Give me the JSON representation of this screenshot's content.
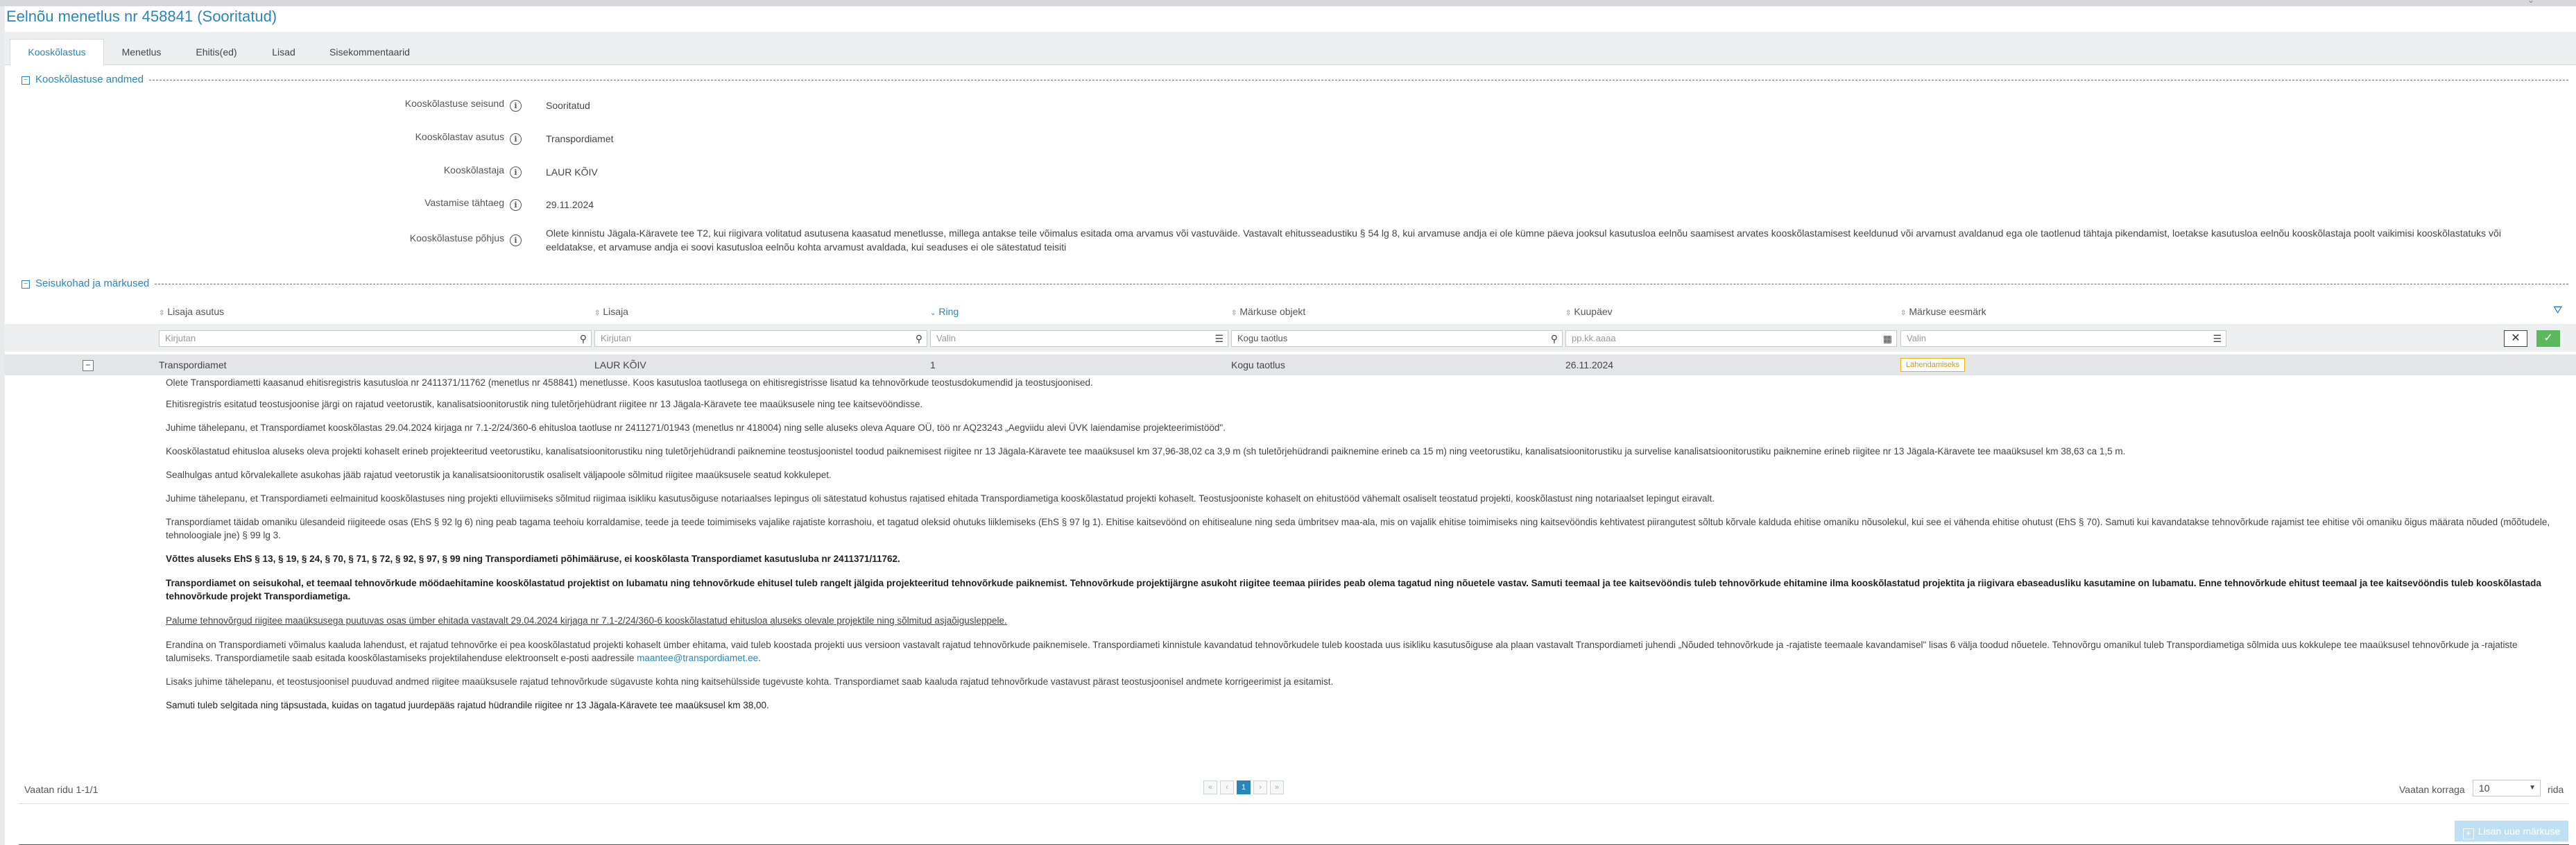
{
  "page": {
    "title": "Eelnõu menetlus nr 458841 (Sooritatud)",
    "tabs": [
      "Kooskõlastus",
      "Menetlus",
      "Ehitis(ed)",
      "Lisad",
      "Sisekommentaarid"
    ]
  },
  "approval_section": {
    "title": "Kooskõlastuse andmed",
    "fields": [
      {
        "label": "Kooskõlastuse seisund",
        "value": "Sooritatud"
      },
      {
        "label": "Kooskõlastav asutus",
        "value": "Transpordiamet"
      },
      {
        "label": "Kooskõlastaja",
        "value": "LAUR KÕIV"
      },
      {
        "label": "Vastamise tähtaeg",
        "value": "29.11.2024"
      },
      {
        "label": "Kooskõlastuse põhjus",
        "value": "Olete kinnistu Jägala-Käravete tee T2, kui riigivara volitatud asutusena kaasatud menetlusse, millega antakse teile võimalus esitada oma arvamus või vastuväide. Vastavalt ehitusseadustiku § 54 lg 8, kui arvamuse andja ei ole kümne päeva jooksul kasutusloa eelnõu saamisest arvates kooskõlastamisest keeldunud või arvamust avaldanud ega ole taotlenud tähtaja pikendamist, loetakse kasutusloa eelnõu kooskõlastaja poolt vaikimisi kooskõlastatuks või eeldatakse, et arvamuse andja ei soovi kasutusloa eelnõu kohta arvamust avaldada, kui seaduses ei ole sätestatud teisiti"
      }
    ]
  },
  "positions_section": {
    "title": "Seisukohad ja märkused",
    "columns": [
      "Lisaja asutus",
      "Lisaja",
      "Ring",
      "Märkuse objekt",
      "Kuupäev",
      "Märkuse eesmärk"
    ],
    "filters": {
      "institution": "Kirjutan",
      "author": "Kirjutan",
      "round": "Valin",
      "object": "Kogu taotlus",
      "date": "pp.kk.aaaa",
      "purpose": "Valin"
    },
    "row": {
      "toggle": "−",
      "institution": "Transpordiamet",
      "author": "LAUR KÕIV",
      "round": "1",
      "object": "Kogu taotlus",
      "date": "26.11.2024",
      "purpose": "Lähendamiseks"
    },
    "comments": [
      {
        "text": "Olete Transpordiametti kaasanud ehitisregistris kasutusloa nr 2411371/11762 (menetlus nr 458841) menetlusse. Koos kasutusloa taotlusega on ehitisregistrisse lisatud ka tehnovõrkude teostusdokumendid ja teostusjoonised."
      },
      {
        "text": "Ehitisregistris esitatud teostusjoonise järgi on rajatud veetorustik, kanalisatsioonitorustik ning tuletõrjehüdrant riigitee nr 13 Jägala-Käravete tee maaüksusele ning tee kaitsevööndisse."
      },
      {
        "text": "Juhime tähelepanu, et Transpordiamet kooskõlastas 29.04.2024 kirjaga nr 7.1-2/24/360-6 ehitusloa taotluse nr 2411271/01943 (menetlus nr 418004) ning selle aluseks oleva Aquare OÜ, töö nr AQ23243 „Aegviidu alevi ÜVK laiendamise projekteerimistööd\"."
      },
      {
        "text": "Kooskõlastatud ehitusloa aluseks oleva projekti kohaselt erineb projekteeritud veetorustiku, kanalisatsioonitorustiku ning tuletõrjehüdrandi paiknemine teostusjoonistel toodud paiknemisest riigitee nr 13 Jägala-Käravete tee maaüksusel km 37,96-38,02 ca 3,9 m (sh tuletõrjehüdrandi paiknemine erineb ca 15 m) ning veetorustiku, kanalisatsioonitorustiku ja survelise kanalisatsioonitorustiku paiknemine erineb riigitee nr 13 Jägala-Käravete tee maaüksusel km 38,63 ca 1,5 m."
      },
      {
        "text": "Sealhulgas antud kõrvalekallete asukohas jääb rajatud veetorustik ja kanalisatsioonitorustik osaliselt väljapoole sõlmitud riigitee maaüksusele seatud kokkulepet."
      },
      {
        "text": "Juhime tähelepanu, et Transpordiameti eelmainitud kooskõlastuses ning projekti elluviimiseks sõlmitud riigimaa isikliku kasutusõiguse notariaalses lepingus oli sätestatud kohustus rajatised ehitada Transpordiametiga kooskõlastatud projekti kohaselt. Teostusjooniste kohaselt on ehitustööd vähemalt osaliselt teostatud projekti, kooskõlastust ning notariaalset lepingut eiravalt."
      },
      {
        "text": "Transpordiamet täidab omaniku ülesandeid riigiteede osas (EhS § 92 lg 6) ning peab tagama teehoiu korraldamise, teede ja teede toimimiseks vajalike rajatiste korrashoiu, et tagatud oleksid ohutuks liiklemiseks (EhS § 97 lg 1). Ehitise kaitsevöönd on ehitisealune ning seda ümbritsev maa-ala, mis on vajalik ehitise toimimiseks ning kaitsevööndis kehtivatest piirangutest sõltub kõrvale kalduda ehitise omaniku nõusolekul, kui see ei vähenda ehitise ohutust (EhS § 70). Samuti kui kavandatakse tehnovõrkude rajamist tee ehitise või omaniku õigus määrata nõuded (mõõtudele, tehnoloogiale jne) § 99 lg 3."
      },
      {
        "text": "Võttes aluseks EhS § 13, § 19, § 24, § 70, § 71, § 72, § 92, § 97, § 99 ning Transpordiameti põhimääruse, ei kooskõlasta Transpordiamet kasutusluba nr 2411371/11762."
      },
      {
        "text": "Transpordiamet on seisukohal, et teemaal tehnovõrkude möödaehitamine kooskõlastatud projektist on lubamatu ning tehnovõrkude ehitusel tuleb rangelt jälgida projekteeritud tehnovõrkude paiknemist. Tehnovõrkude projektijärgne asukoht riigitee teemaa piirides peab olema tagatud ning nõuetele vastav. Samuti teemaal ja tee kaitsevööndis tuleb tehnovõrkude ehitamine ilma kooskõlastatud projektita ja riigivara ebaseadusliku kasutamine on lubamatu. Enne tehnovõrkude ehitust teemaal ja tee kaitsevööndis tuleb kooskõlastada tehnovõrkude projekt Transpordiametiga."
      },
      {
        "text": "Palume tehnovõrgud riigitee maaüksusega puutuvas osas ümber ehitada vastavalt 29.04.2024 kirjaga nr 7.1-2/24/360-6 kooskõlastatud ehitusloa aluseks olevale projektile ning sõlmitud asjaõigusleppele."
      },
      {
        "text": "Erandina on Transpordiameti võimalus kaaluda lahendust, et rajatud tehnovõrke ei pea kooskõlastatud projekti kohaselt ümber ehitama, vaid tuleb koostada projekti uus versioon vastavalt rajatud tehnovõrkude paiknemisele. Transpordiameti kinnistule kavandatud tehnovõrkudele tuleb koostada uus isikliku kasutusõiguse ala plaan vastavalt Transpordiameti juhendi „Nõuded tehnovõrkude ja -rajatiste teemaale kavandamisel\" lisas 6 välja toodud nõuetele. Tehnovõrgu omanikul tuleb Transpordiametiga sõlmida uus kokkulepe tee maaüksusel tehnovõrkude ja -rajatiste talumiseks. Transpordiametile saab esitada kooskõlastamiseks projektilahenduse elektroonselt e-posti aadressile",
        "link": "maantee@transpordiamet.ee",
        "tail": "."
      },
      {
        "text": "Lisaks juhime tähelepanu, et teostusjoonisel puuduvad andmed riigitee maaüksusele rajatud tehnovõrkude sügavuste kohta ning kaitsehülsside tugevuste kohta. Transpordiamet saab kaaluda rajatud tehnovõrkude vastavust pärast teostusjoonisel andmete korrigeerimist ja esitamist."
      },
      {
        "text": "Samuti tuleb selgitada ning täpsustada, kuidas on tagatud juurdepääs rajatud hüdrandile riigitee nr 13 Jägala-Käravete tee maaüksusel km 38,00."
      }
    ]
  },
  "pagination": {
    "info": "Vaatan ridu 1-1/1",
    "first": "«",
    "prev": "‹",
    "current": "1",
    "next": "›",
    "last": "»",
    "per_page_label": "Vaatan korraga",
    "per_page_value": "10",
    "per_page_unit": "rida"
  },
  "actions": {
    "add_comment": "Lisan uue märkuse"
  },
  "colors": {
    "accent": "#2a86b8",
    "badge": "#f0b400",
    "confirm": "#5cb85c"
  }
}
